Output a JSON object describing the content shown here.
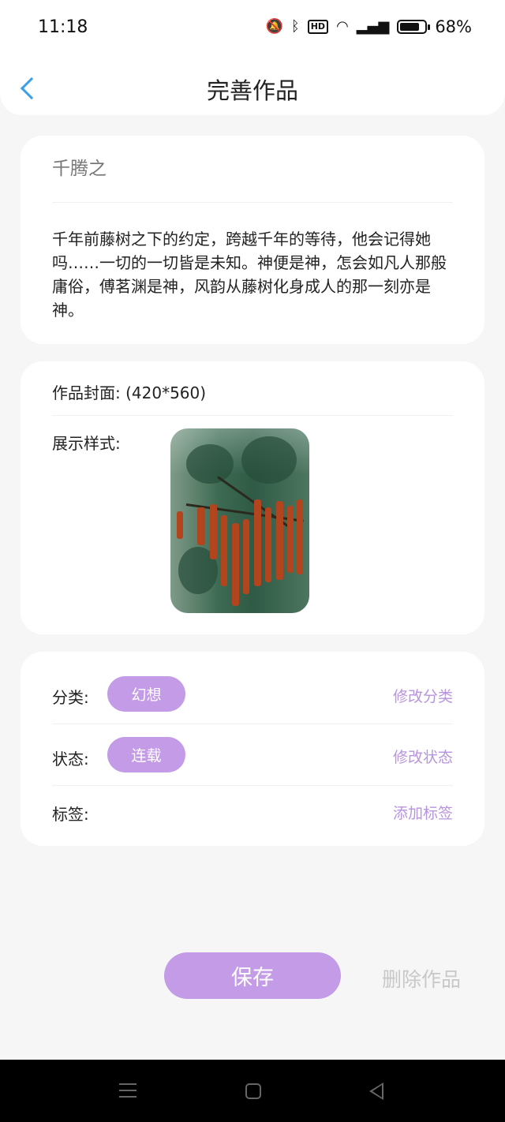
{
  "status_bar": {
    "time": "11:18",
    "battery": "68%",
    "icons": [
      "mute-bell-icon",
      "bluetooth-icon",
      "hd-icon",
      "wifi-icon",
      "5g-signal-icon",
      "battery-icon"
    ],
    "hd_label": "HD"
  },
  "header": {
    "title": "完善作品",
    "back_icon": "chevron-left-icon"
  },
  "work": {
    "title": "千腾之",
    "synopsis": "千年前藤树之下的约定，跨越千年的等待，他会记得她吗……一切的一切皆是未知。神便是神，怎会如凡人那般庸俗，傅茗渊是神，风韵从藤树化身成人的那一刻亦是神。"
  },
  "cover": {
    "label": "作品封面: (420*560)",
    "style_label": "展示样式:"
  },
  "meta": {
    "category_label": "分类:",
    "category_value": "幻想",
    "category_action": "修改分类",
    "status_label": "状态:",
    "status_value": "连载",
    "status_action": "修改状态",
    "tags_label": "标签:",
    "tags_action": "添加标签"
  },
  "actions": {
    "save": "保存",
    "delete": "删除作品"
  },
  "colors": {
    "accent": "#c39be6",
    "action_text": "#b794dd",
    "back_arrow": "#3aa0e8"
  }
}
